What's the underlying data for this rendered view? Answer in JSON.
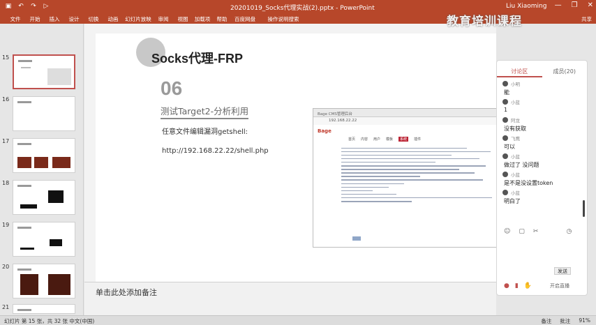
{
  "window": {
    "title": "20201019_Socks代理实战(2).pptx - PowerPoint",
    "user": "Liu Xiaoming",
    "watermark": "教育培训课程",
    "qat_icons": [
      "save-icon",
      "undo-icon",
      "redo-icon",
      "present-icon"
    ],
    "controls": [
      "minimize",
      "restore",
      "close"
    ]
  },
  "ribbon": {
    "tabs": [
      "文件",
      "开始",
      "插入",
      "设计",
      "切换",
      "动画",
      "幻灯片放映",
      "审阅",
      "视图",
      "加载项",
      "帮助",
      "百度网盘"
    ],
    "search": "操作说明搜索",
    "share": "共享"
  },
  "thumbnails": [
    {
      "num": "15",
      "selected": true
    },
    {
      "num": "16",
      "selected": false
    },
    {
      "num": "17",
      "selected": false
    },
    {
      "num": "18",
      "selected": false
    },
    {
      "num": "19",
      "selected": false
    },
    {
      "num": "20",
      "selected": false
    },
    {
      "num": "21",
      "selected": false
    }
  ],
  "slide": {
    "title": "Socks代理-FRP",
    "number": "06",
    "subtitle": "测试Target2-分析利用",
    "line1": "任意文件编辑漏洞getshell:",
    "line2": "http://192.168.22.22/shell.php"
  },
  "screenshot": {
    "tab_text": "Bage CMS管理后台",
    "address": "192.168.22.22",
    "logo": "Bage",
    "nav_items": [
      "首页",
      "内容",
      "用户",
      "模板",
      "系统",
      "插件"
    ],
    "active_nav": 4
  },
  "notes": {
    "placeholder": "单击此处添加备注"
  },
  "chat": {
    "tab_discussion": "讨论区",
    "tab_members": "成员(20)",
    "messages": [
      {
        "who": "小明",
        "text": "能"
      },
      {
        "who": "小蓝",
        "text": "1"
      },
      {
        "who": "阿龙",
        "text": "没有获取"
      },
      {
        "who": "飞鹰",
        "text": "可以"
      },
      {
        "who": "小蓝",
        "text": "做过了 没问题"
      },
      {
        "who": "小蓝",
        "text": "是不是没设置token"
      },
      {
        "who": "小蓝",
        "text": "明白了"
      }
    ],
    "send": "发送",
    "bottom_label": "开启直播"
  },
  "statusbar": {
    "left": "幻灯片 第 15 张，共 32 张    中文(中国)",
    "notes": "备注",
    "comments": "批注",
    "zoom": "91%"
  }
}
